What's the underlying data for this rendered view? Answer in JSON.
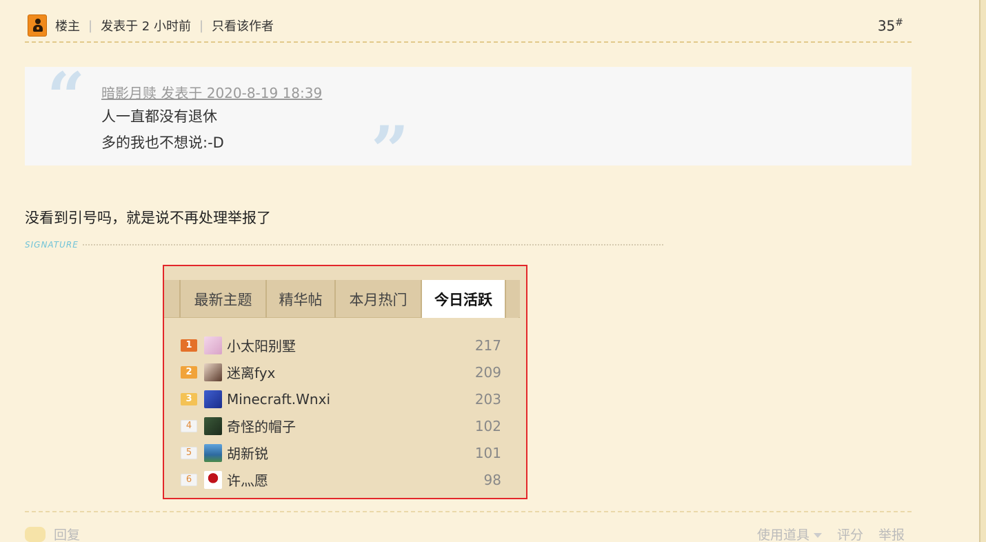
{
  "header": {
    "role": "楼主",
    "posted": "发表于 2 小时前",
    "only_author": "只看该作者",
    "floor": "35",
    "floor_mark": "#"
  },
  "quote": {
    "meta": "暗影月赎 发表于 2020-8-19 18:39",
    "line1": "人一直都没有退休",
    "line2": "多的我也不想说:-D"
  },
  "reply_text": "没看到引号吗，就是说不再处理举报了",
  "signature_label": "SIGNATURE",
  "sig_image": {
    "tabs": [
      "最新主题",
      "精华帖",
      "本月热门",
      "今日活跃"
    ],
    "active_tab": "今日活跃",
    "ranks": [
      {
        "rank": "1",
        "name": "小太阳别墅",
        "score": "217"
      },
      {
        "rank": "2",
        "name": "迷离fyx",
        "score": "209"
      },
      {
        "rank": "3",
        "name": "Minecraft.Wnxi",
        "score": "203"
      },
      {
        "rank": "4",
        "name": "奇怪的帽子",
        "score": "102"
      },
      {
        "rank": "5",
        "name": "胡新锐",
        "score": "101"
      },
      {
        "rank": "6",
        "name": "许灬愿",
        "score": "98"
      }
    ]
  },
  "footer": {
    "reply": "回复",
    "use_tool": "使用道具",
    "rate": "评分",
    "report": "举报"
  }
}
